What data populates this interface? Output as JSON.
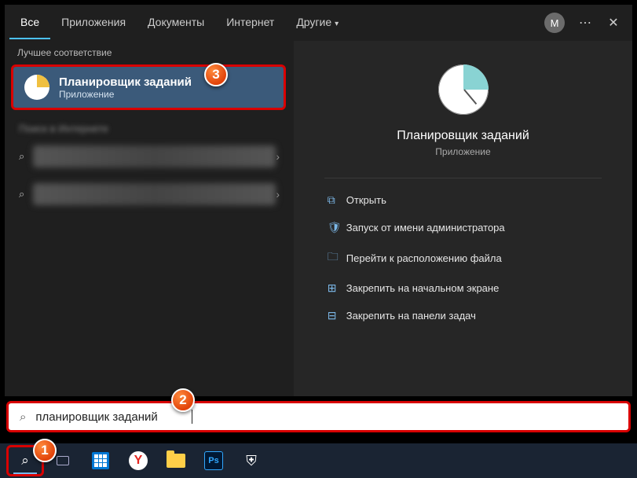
{
  "tabs": {
    "all": "Все",
    "apps": "Приложения",
    "docs": "Документы",
    "web": "Интернет",
    "more": "Другие"
  },
  "avatar_initial": "M",
  "section_best": "Лучшее соответствие",
  "best_match": {
    "title": "Планировщик заданий",
    "subtitle": "Приложение"
  },
  "section_web": "Поиск в Интернете",
  "details": {
    "title": "Планировщик заданий",
    "subtitle": "Приложение"
  },
  "actions": {
    "open": "Открыть",
    "admin": "Запуск от имени администратора",
    "location": "Перейти к расположению файла",
    "pin_start": "Закрепить на начальном экране",
    "pin_taskbar": "Закрепить на панели задач"
  },
  "search_value": "планировщик заданий",
  "badges": {
    "b1": "1",
    "b2": "2",
    "b3": "3"
  },
  "taskbar": {
    "yandex": "Y",
    "ps": "Ps"
  }
}
